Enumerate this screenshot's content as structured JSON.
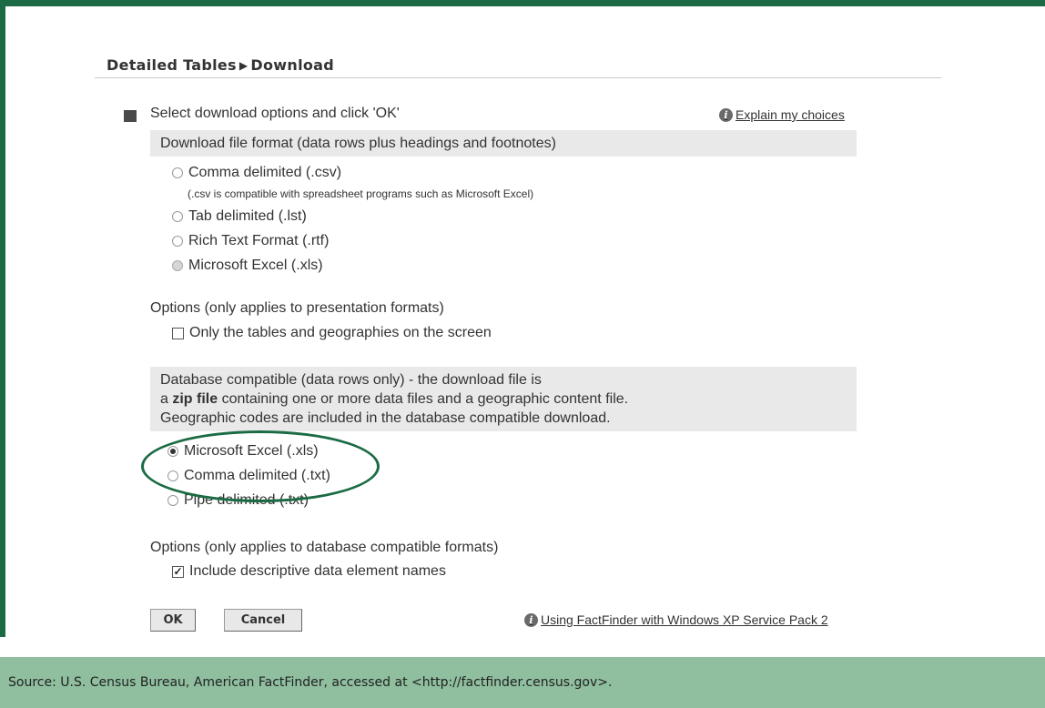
{
  "breadcrumb": {
    "parent": "Detailed Tables",
    "separator": "▶",
    "current": "Download"
  },
  "intro": {
    "text": "Select download options and click 'OK'"
  },
  "explain_link": {
    "label": "Explain my choices",
    "icon": "info-icon"
  },
  "file_format": {
    "header": "Download file format (data rows plus headings and footnotes)",
    "options": [
      {
        "label": "Comma delimited (.csv)",
        "note": "(.csv is compatible with spreadsheet programs such as Microsoft Excel)"
      },
      {
        "label": "Tab delimited (.lst)"
      },
      {
        "label": "Rich Text Format (.rtf)"
      },
      {
        "label": "Microsoft Excel (.xls)"
      }
    ]
  },
  "presentation_options": {
    "label": "Options (only applies to presentation formats)",
    "checkbox_label": "Only the tables and geographies on the screen",
    "checked": false
  },
  "database": {
    "header_line1": "Database compatible (data rows only) - the download file is",
    "header_line2_prefix": "a ",
    "header_line2_bold": "zip file",
    "header_line2_suffix": " containing one or more data files and a geographic content file.",
    "header_line3": "Geographic codes are included in the database compatible download.",
    "options": [
      {
        "label": "Microsoft Excel (.xls)",
        "selected": true
      },
      {
        "label": "Comma delimited (.txt)",
        "selected": false
      },
      {
        "label": "Pipe delimited (.txt)",
        "selected": false
      }
    ]
  },
  "database_options": {
    "label": "Options (only applies to database compatible formats)",
    "checkbox_label": "Include descriptive data element names",
    "checked": true
  },
  "buttons": {
    "ok": "OK",
    "cancel": "Cancel"
  },
  "xp_link": {
    "label": "Using FactFinder with Windows XP Service Pack 2",
    "icon": "info-icon"
  },
  "footer": {
    "source": "Source: U.S. Census Bureau, American FactFinder, accessed at <http://factfinder.census.gov>."
  },
  "colors": {
    "frame": "#1d6b46",
    "footer_bg": "#8fbf9f",
    "header_bg": "#e9e9e9",
    "highlight_ellipse": "#1a6b44"
  }
}
